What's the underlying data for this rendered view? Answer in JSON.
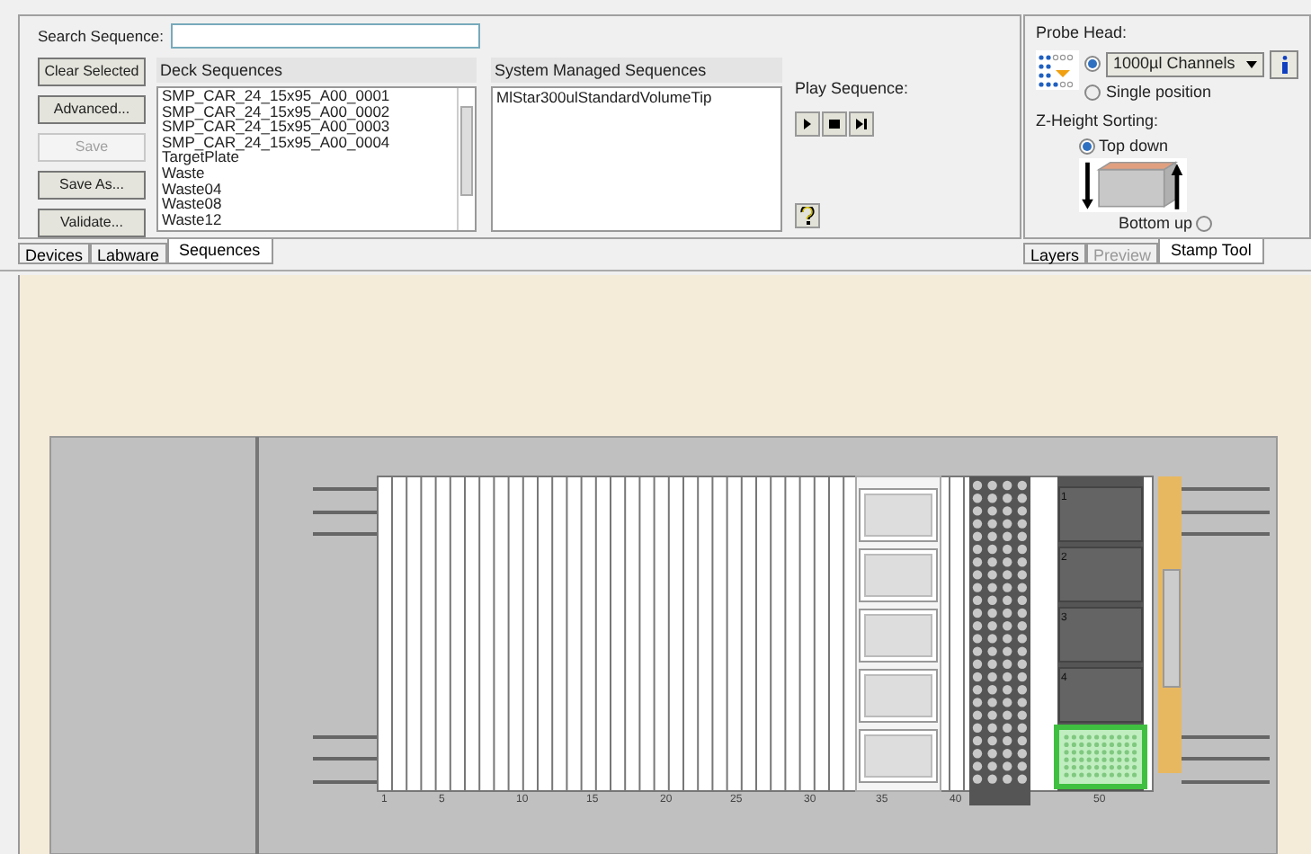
{
  "search": {
    "label": "Search Sequence:"
  },
  "buttons": [
    {
      "label": "Clear Selected",
      "disabled": false
    },
    {
      "label": "Advanced...",
      "disabled": false
    },
    {
      "label": "Save",
      "disabled": true
    },
    {
      "label": "Save As...",
      "disabled": false
    },
    {
      "label": "Validate...",
      "disabled": false
    }
  ],
  "deck_sequences": {
    "title": "Deck Sequences",
    "items": [
      "SMP_CAR_24_15x95_A00_0001",
      "SMP_CAR_24_15x95_A00_0002",
      "SMP_CAR_24_15x95_A00_0003",
      "SMP_CAR_24_15x95_A00_0004",
      "TargetPlate",
      "Waste",
      "Waste04",
      "Waste08",
      "Waste12"
    ]
  },
  "system_sequences": {
    "title": "System Managed Sequences",
    "items": [
      "MlStar300ulStandardVolumeTip"
    ]
  },
  "play_sequence": {
    "label": "Play Sequence:",
    "buttons": [
      {
        "kind": "play"
      },
      {
        "kind": "stop"
      },
      {
        "kind": "step"
      }
    ]
  },
  "left_tabs": [
    {
      "label": "Devices",
      "selected": false
    },
    {
      "label": "Labware",
      "selected": false
    },
    {
      "label": "Sequences",
      "selected": true
    }
  ],
  "probe_head": {
    "label": "Probe Head:",
    "options": [
      {
        "kind": "dropdown",
        "label": "1000µl Channels",
        "selected": true
      },
      {
        "kind": "radio",
        "label": "Single position",
        "selected": false
      }
    ]
  },
  "z_height_sorting": {
    "label": "Z-Height Sorting:",
    "options": [
      {
        "label": "Top down",
        "selected": true
      },
      {
        "label": "Bottom up",
        "selected": false
      }
    ]
  },
  "right_tabs": [
    {
      "label": "Layers",
      "selected": false,
      "disabled": false
    },
    {
      "label": "Preview",
      "selected": false,
      "disabled": true
    },
    {
      "label": "Stamp Tool",
      "selected": true,
      "disabled": false
    }
  ],
  "deck": {
    "track_numbers": [
      "1",
      "5",
      "10",
      "15",
      "20",
      "25",
      "30",
      "35",
      "40",
      "50"
    ],
    "position_numbers": [
      "1",
      "2",
      "3",
      "4"
    ]
  }
}
